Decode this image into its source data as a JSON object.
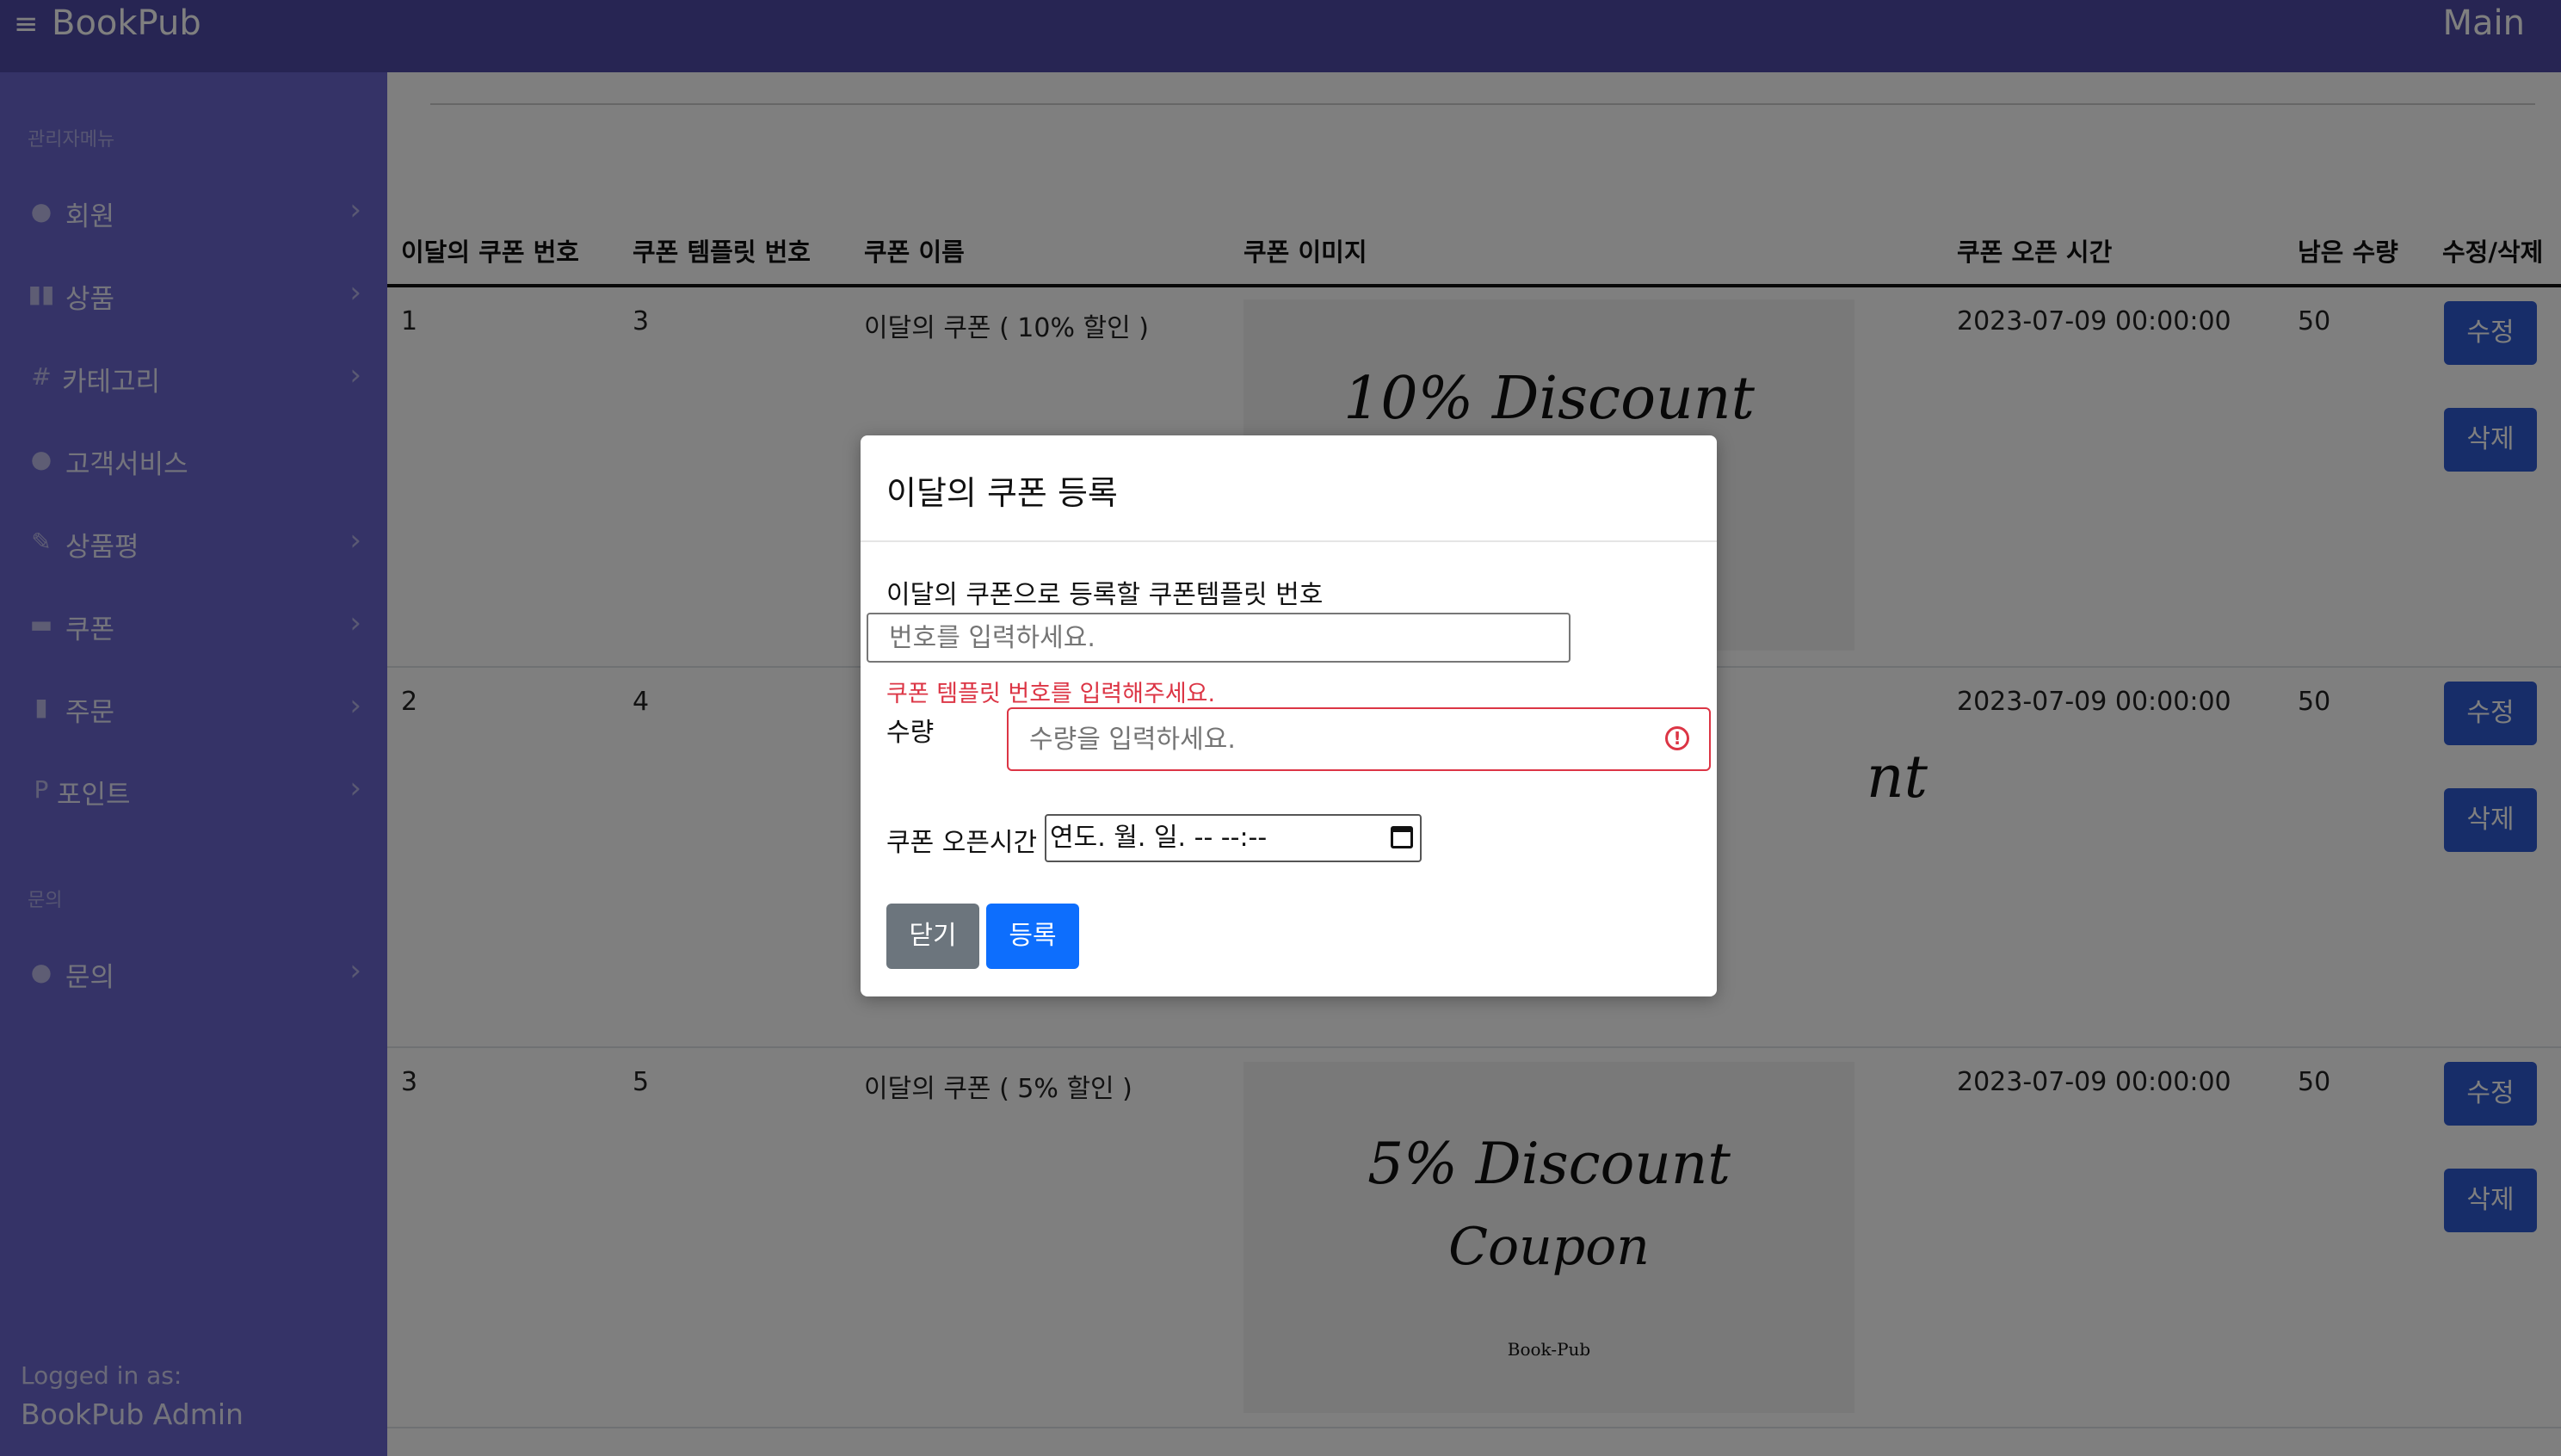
{
  "topbar": {
    "brand": "BookPub",
    "main_link": "Main",
    "menu_icon": "≡"
  },
  "sidebar": {
    "heading_admin": "관리자메뉴",
    "items": [
      {
        "label": "회원",
        "icon": "user-circle-icon"
      },
      {
        "label": "상품",
        "icon": "book-open-icon"
      },
      {
        "label": "카테고리",
        "icon": "hash-icon"
      },
      {
        "label": "고객서비스",
        "icon": "info-circle-icon"
      },
      {
        "label": "상품평",
        "icon": "edit-icon"
      },
      {
        "label": "쿠폰",
        "icon": "credit-card-icon"
      },
      {
        "label": "주문",
        "icon": "trash-icon"
      },
      {
        "label": "포인트",
        "icon": "point-p-icon"
      }
    ],
    "heading_inquiry": "문의",
    "inquiry_item": {
      "label": "문의",
      "icon": "question-circle-icon"
    },
    "logged_label": "Logged in as:",
    "logged_user": "BookPub Admin"
  },
  "table": {
    "headers": [
      "이달의 쿠폰 번호",
      "쿠폰 템플릿 번호",
      "쿠폰 이름",
      "쿠폰 이미지",
      "쿠폰 오픈 시간",
      "남은 수량",
      "수정/삭제"
    ],
    "rows": [
      {
        "id": "1",
        "template": "3",
        "name": "이달의 쿠폰 ( 10% 할인 )",
        "image_text": "10% Discount",
        "open": "2023-07-09 00:00:00",
        "qty": "50"
      },
      {
        "id": "2",
        "template": "4",
        "name": "",
        "image_text": "nt",
        "open": "2023-07-09 00:00:00",
        "qty": "50"
      },
      {
        "id": "3",
        "template": "5",
        "name": "이달의 쿠폰 ( 5% 할인 )",
        "image_text": "5% Discount",
        "image_sub": "Coupon",
        "image_small": "Book-Pub",
        "open": "2023-07-09 00:00:00",
        "qty": "50"
      }
    ],
    "edit_label": "수정",
    "delete_label": "삭제"
  },
  "modal": {
    "title": "이달의 쿠폰 등록",
    "template_label": "이달의 쿠폰으로 등록할 쿠폰템플릿 번호",
    "template_placeholder": "번호를 입력하세요.",
    "template_error": "쿠폰 템플릿 번호를 입력해주세요.",
    "qty_label": "수량",
    "qty_placeholder": "수량을 입력하세요.",
    "open_label": "쿠폰 오픈시간",
    "open_value": "연도. 월. 일. -- --:--",
    "close_label": "닫기",
    "submit_label": "등록"
  },
  "colors": {
    "topbar": "#4e4ba6",
    "sidebar": "#6a67cf",
    "primary": "#0d6efd",
    "danger": "#dc3545"
  }
}
